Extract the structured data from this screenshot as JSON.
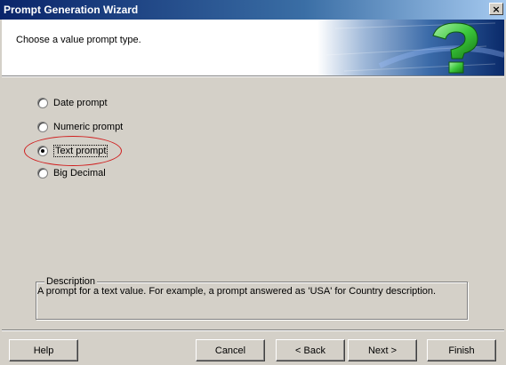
{
  "window": {
    "title": "Prompt Generation Wizard",
    "close_glyph": "×"
  },
  "header": {
    "instruction": "Choose a value prompt type.",
    "graphic_icon": "question-mark-icon"
  },
  "options": [
    {
      "label": "Date prompt",
      "checked": false
    },
    {
      "label": "Numeric prompt",
      "checked": false
    },
    {
      "label": "Text prompt",
      "checked": true
    },
    {
      "label": "Big Decimal",
      "checked": false
    }
  ],
  "description": {
    "legend": "Description",
    "text": "A prompt for a text value.  For example, a prompt answered as 'USA' for Country description."
  },
  "buttons": {
    "help": "Help",
    "cancel": "Cancel",
    "back": "< Back",
    "next": "Next >",
    "finish": "Finish"
  },
  "colors": {
    "title_bar_start": "#0a246a",
    "title_bar_end": "#a6caf0",
    "highlight_ellipse": "#d02020",
    "question_mark": "#3cc83c"
  }
}
